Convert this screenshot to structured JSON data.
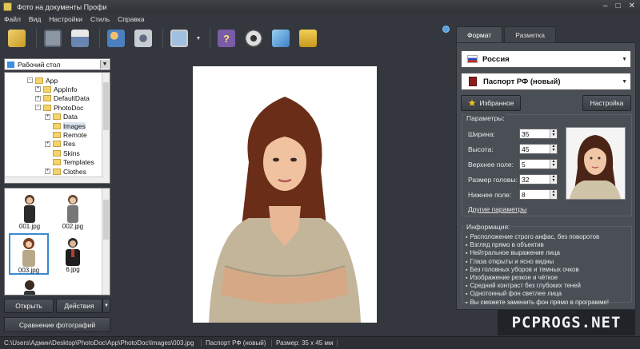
{
  "window": {
    "title": "Фото на документы Профи",
    "controls": [
      "–",
      "□",
      "✕"
    ]
  },
  "menu": [
    "Файл",
    "Вид",
    "Настройки",
    "Стиль",
    "Справка"
  ],
  "toolbar": {
    "icons": [
      "open-icon",
      "save-icon",
      "print-icon",
      "users-icon",
      "camera-icon",
      "display-icon",
      "help-icon",
      "film-icon",
      "3d-box-icon",
      "cart-icon"
    ]
  },
  "left": {
    "folder": "Рабочий стол",
    "tree": [
      {
        "label": "App",
        "exp": "-",
        "depth": 2
      },
      {
        "label": "AppInfo",
        "exp": "+",
        "depth": 3
      },
      {
        "label": "DefaultData",
        "exp": "+",
        "depth": 3
      },
      {
        "label": "PhotoDoc",
        "exp": "-",
        "depth": 3
      },
      {
        "label": "Data",
        "exp": "+",
        "depth": 4
      },
      {
        "label": "Images",
        "exp": "",
        "depth": 4
      },
      {
        "label": "Remote",
        "exp": "",
        "depth": 4
      },
      {
        "label": "Res",
        "exp": "+",
        "depth": 4
      },
      {
        "label": "Skins",
        "exp": "",
        "depth": 4
      },
      {
        "label": "Templates",
        "exp": "",
        "depth": 4
      },
      {
        "label": "Clothes",
        "exp": "+",
        "depth": 4
      }
    ],
    "thumbnails": [
      "001.jpg",
      "002.jpg",
      "003.jpg",
      "6.jpg"
    ],
    "open_button": "Открыть",
    "actions_button": "Действия",
    "compare_button": "Сравнение фотографий"
  },
  "right": {
    "tabs": [
      "Формат",
      "Разметка"
    ],
    "country": "Россия",
    "document": "Паспорт РФ (новый)",
    "favorites_button": "Избранное",
    "settings_button": "Настройка",
    "params_title": "Параметры:",
    "params": [
      {
        "label": "Ширина:",
        "value": "35"
      },
      {
        "label": "Высота:",
        "value": "45"
      },
      {
        "label": "Верхнее поле:",
        "value": "5"
      },
      {
        "label": "Размер головы:",
        "value": "32"
      },
      {
        "label": "Нижнее поле:",
        "value": "8"
      }
    ],
    "other_params_link": "Другие параметры",
    "info_title": "Информация:",
    "info": [
      "Расположение строго анфас, без поворотов",
      "Взгляд прямо в объектив",
      "Нейтральное выражение лица",
      "Глаза открыты и ясно видны",
      "Без головных уборов и темных очков",
      "Изображение резкое и чёткое",
      "Средний контраст без глубоких теней",
      "Однотонный фон светлее лица",
      "Вы сможете заменить фон прямо в программе!"
    ]
  },
  "status": {
    "path": "C:\\Users\\Админ\\Desktop\\PhotoDoc\\App\\PhotoDoc\\Images\\003.jpg",
    "format": "Паспорт РФ (новый)",
    "size": "Размер: 35 x 45 мм"
  },
  "watermark": "PCPROGS.NET"
}
